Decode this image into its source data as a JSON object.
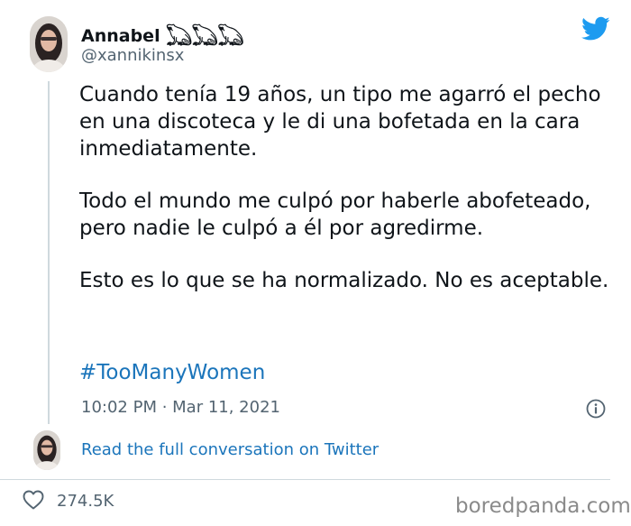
{
  "author": {
    "name": "Annabel 𓆏𓆏𓆏",
    "handle": "@xannikinsx"
  },
  "tweet": {
    "paragraphs": [
      "Cuando tenía 19 años, un tipo me agarró el pecho en una discoteca y le di una bofetada en la cara inmediatamente.",
      "Todo el mundo me culpó por haberle abofeteado, pero nadie le culpó a él por agredirme.",
      "Esto es lo que se ha normalizado. No es aceptable."
    ],
    "hashtag": "#TooManyWomen",
    "timestamp": "10:02 PM · Mar 11, 2021"
  },
  "read_conversation": "Read the full conversation on Twitter",
  "likes": "274.5K",
  "watermark": "boredpanda.com",
  "icons": {
    "logo": "twitter-bird-icon",
    "info": "info-icon",
    "like": "heart-icon"
  },
  "colors": {
    "link": "#1b75bb",
    "twitter_blue": "#1d9bf0",
    "muted": "#536471"
  }
}
